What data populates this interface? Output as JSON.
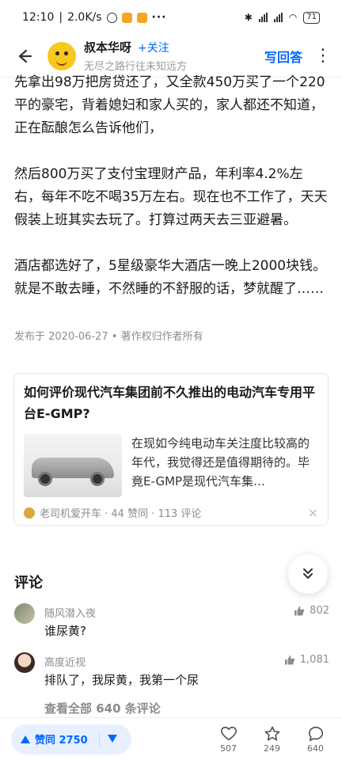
{
  "status_bar": {
    "time": "12:10",
    "speed": "2.0K/s",
    "dots": "···",
    "battery": "71"
  },
  "header": {
    "author_name": "叔本华呀",
    "follow_label": "+关注",
    "author_bio": "无尽之路行往未知远方",
    "write_answer_label": "写回答"
  },
  "answer": {
    "paragraphs": [
      "先拿出98万把房贷还了，又全款450万买了一个220平的豪宅，背着媳妇和家人买的，家人都还不知道，正在酝酿怎么告诉他们，",
      "然后800万买了支付宝理财产品，年利率4.2%左右，每年不吃不喝35万左右。现在也不工作了，天天假装上班其实去玩了。打算过两天去三亚避暑。",
      "酒店都选好了，5星级豪华大酒店一晚上2000块钱。就是不敢去睡，不然睡的不舒服的话，梦就醒了……"
    ],
    "meta": "发布于 2020-06-27 • 著作权归作者所有"
  },
  "related_card": {
    "title": "如何评价现代汽车集团前不久推出的电动汽车专用平台E-GMP?",
    "excerpt": "在现如今纯电动车关注度比较高的年代，我觉得还是值得期待的。毕竟E-GMP是现代汽车集…",
    "footer": "老司机爱开车 · 44 赞同 · 113 评论",
    "close": "×"
  },
  "comments": {
    "title": "评论",
    "items": [
      {
        "name": "随风潜入夜",
        "text": "谁尿黄?",
        "likes": "802"
      },
      {
        "name": "高度近视",
        "text": "排队了，我尿黄，我第一个尿",
        "likes": "1,081"
      }
    ],
    "view_all": "查看全部 640 条评论"
  },
  "bottom_bar": {
    "vote_label": "赞同 2750",
    "like_count": "507",
    "favorite_count": "249",
    "comment_count": "640"
  },
  "colors": {
    "accent": "#0066ff",
    "vote_bg": "#e8f0ff"
  }
}
